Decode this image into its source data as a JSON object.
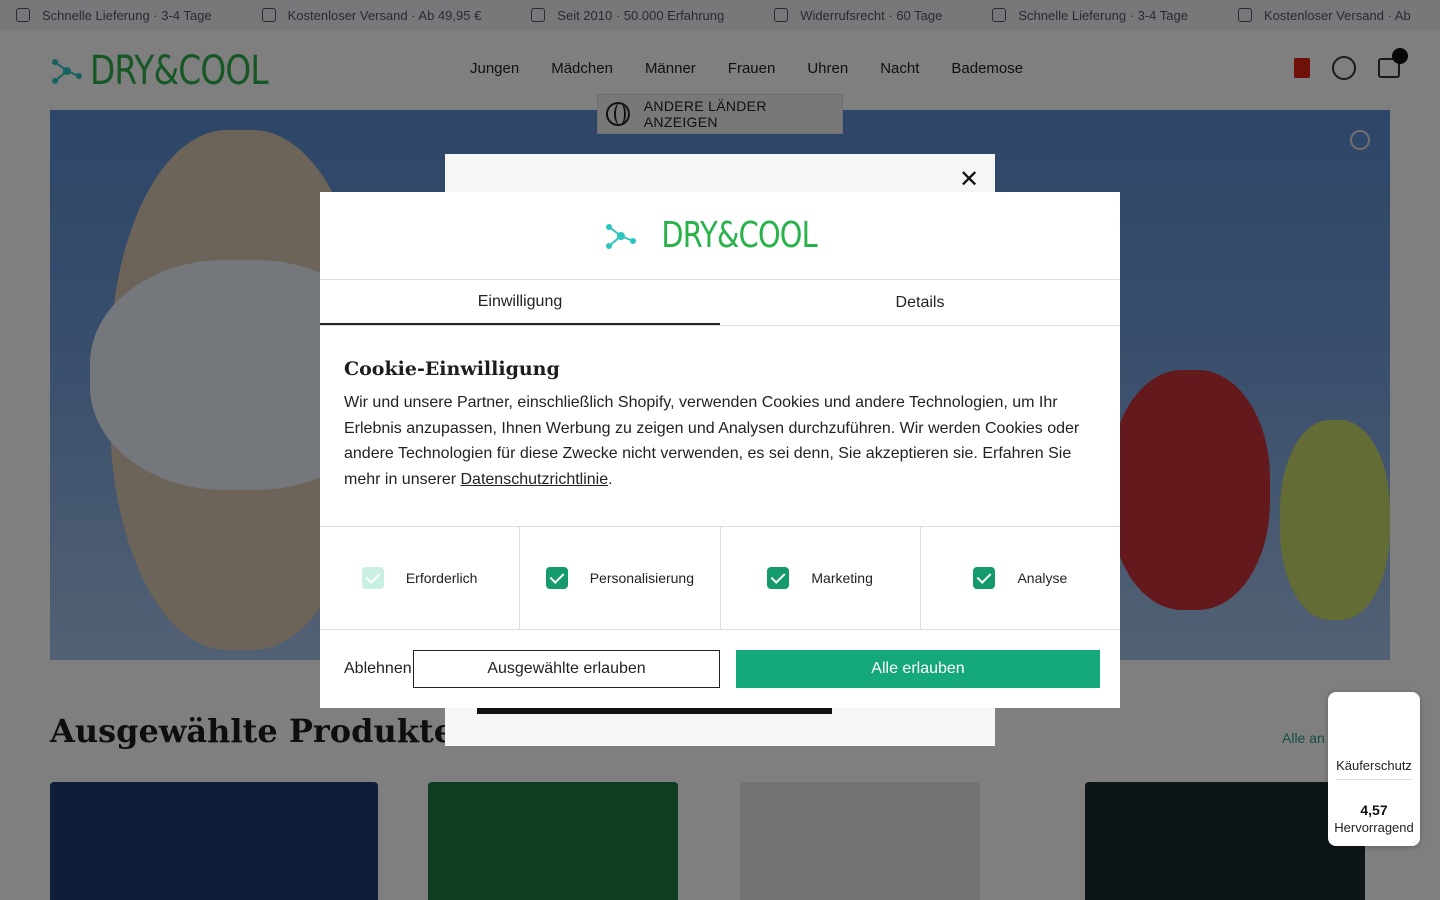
{
  "announcement": {
    "items": [
      "Schnelle Lieferung · 3-4 Tage",
      "Kostenloser Versand · Ab 49,95 €",
      "Seit 2010 · 50.000 Erfahrung",
      "Widerrufsrecht · 60 Tage",
      "Schnelle Lieferung · 3-4 Tage",
      "Kostenloser Versand · Ab"
    ]
  },
  "header": {
    "logo_text": "DRY&COOL",
    "nav": [
      "Jungen",
      "Mädchen",
      "Männer",
      "Frauen",
      "Uhren",
      "Nacht",
      "Bademose"
    ]
  },
  "region_button": {
    "label": "ANDERE LÄNDER ANZEIGEN"
  },
  "section": {
    "title": "Ausgewählte Produkte",
    "link": "Alle an"
  },
  "popup": {
    "close": "✕"
  },
  "cookie": {
    "logo_text": "DRY&COOL",
    "tabs": [
      "Einwilligung",
      "Details"
    ],
    "title": "Cookie-Einwilligung",
    "text": "Wir und unsere Partner, einschließlich Shopify, verwenden Cookies und andere Technologien, um Ihr Erlebnis anzupassen, Ihnen Werbung zu zeigen und Analysen durchzuführen. Wir werden Cookies oder andere Technologien für diese Zwecke nicht verwenden, es sei denn, Sie akzeptieren sie. Erfahren Sie mehr in unserer ",
    "link": "Datenschutzrichtlinie",
    "text_end": ".",
    "categories": [
      {
        "label": "Erforderlich",
        "checked": true,
        "disabled": true
      },
      {
        "label": "Personalisierung",
        "checked": true,
        "disabled": false
      },
      {
        "label": "Marketing",
        "checked": true,
        "disabled": false
      },
      {
        "label": "Analyse",
        "checked": true,
        "disabled": false
      }
    ],
    "decline": "Ablehnen",
    "allow_selected": "Ausgewählte erlauben",
    "allow_all": "Alle erlauben"
  },
  "trust_badge": {
    "label": "Käuferschutz",
    "score": "4,57",
    "rating": "Hervorragend"
  },
  "colors": {
    "brand_green": "#27b34a",
    "accent": "#15a87b",
    "checkbox": "#159a6e"
  }
}
